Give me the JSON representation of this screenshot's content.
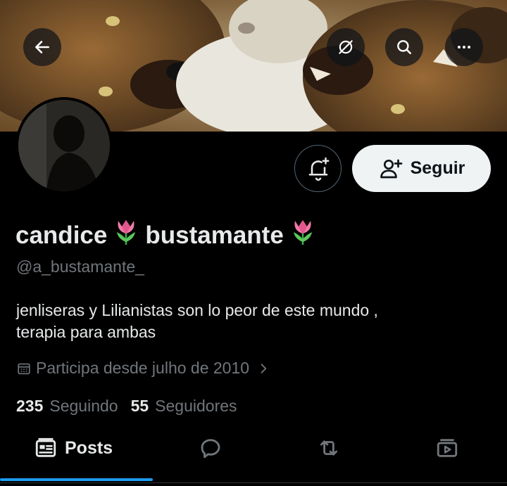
{
  "header": {
    "back_icon": "arrow-left-icon",
    "grok_icon": "grok-icon",
    "search_icon": "search-icon",
    "more_icon": "more-horizontal-icon"
  },
  "profile": {
    "name_part1": "candice",
    "name_part2": "bustamante",
    "name_emoji": "tulip",
    "handle": "@a_bustamante_",
    "bio_line1": "jenliseras y Lilianistas son lo peor de este mundo ,",
    "bio_line2": "terapia para ambas",
    "joined": "Participa desde julho de 2010",
    "following_count": "235",
    "following_label": "Seguindo",
    "followers_count": "55",
    "followers_label": "Seguidores"
  },
  "actions": {
    "follow_label": "Seguir"
  },
  "tabs": [
    {
      "label": "Posts",
      "icon": "posts-icon",
      "active": true
    },
    {
      "label": "",
      "icon": "replies-icon",
      "active": false
    },
    {
      "label": "",
      "icon": "retweet-icon",
      "active": false
    },
    {
      "label": "",
      "icon": "media-icon",
      "active": false
    }
  ],
  "colors": {
    "background": "#000000",
    "text_primary": "#e7e9ea",
    "text_secondary": "#71767b",
    "accent": "#1d9bf0",
    "follow_button_bg": "#eff3f4"
  }
}
